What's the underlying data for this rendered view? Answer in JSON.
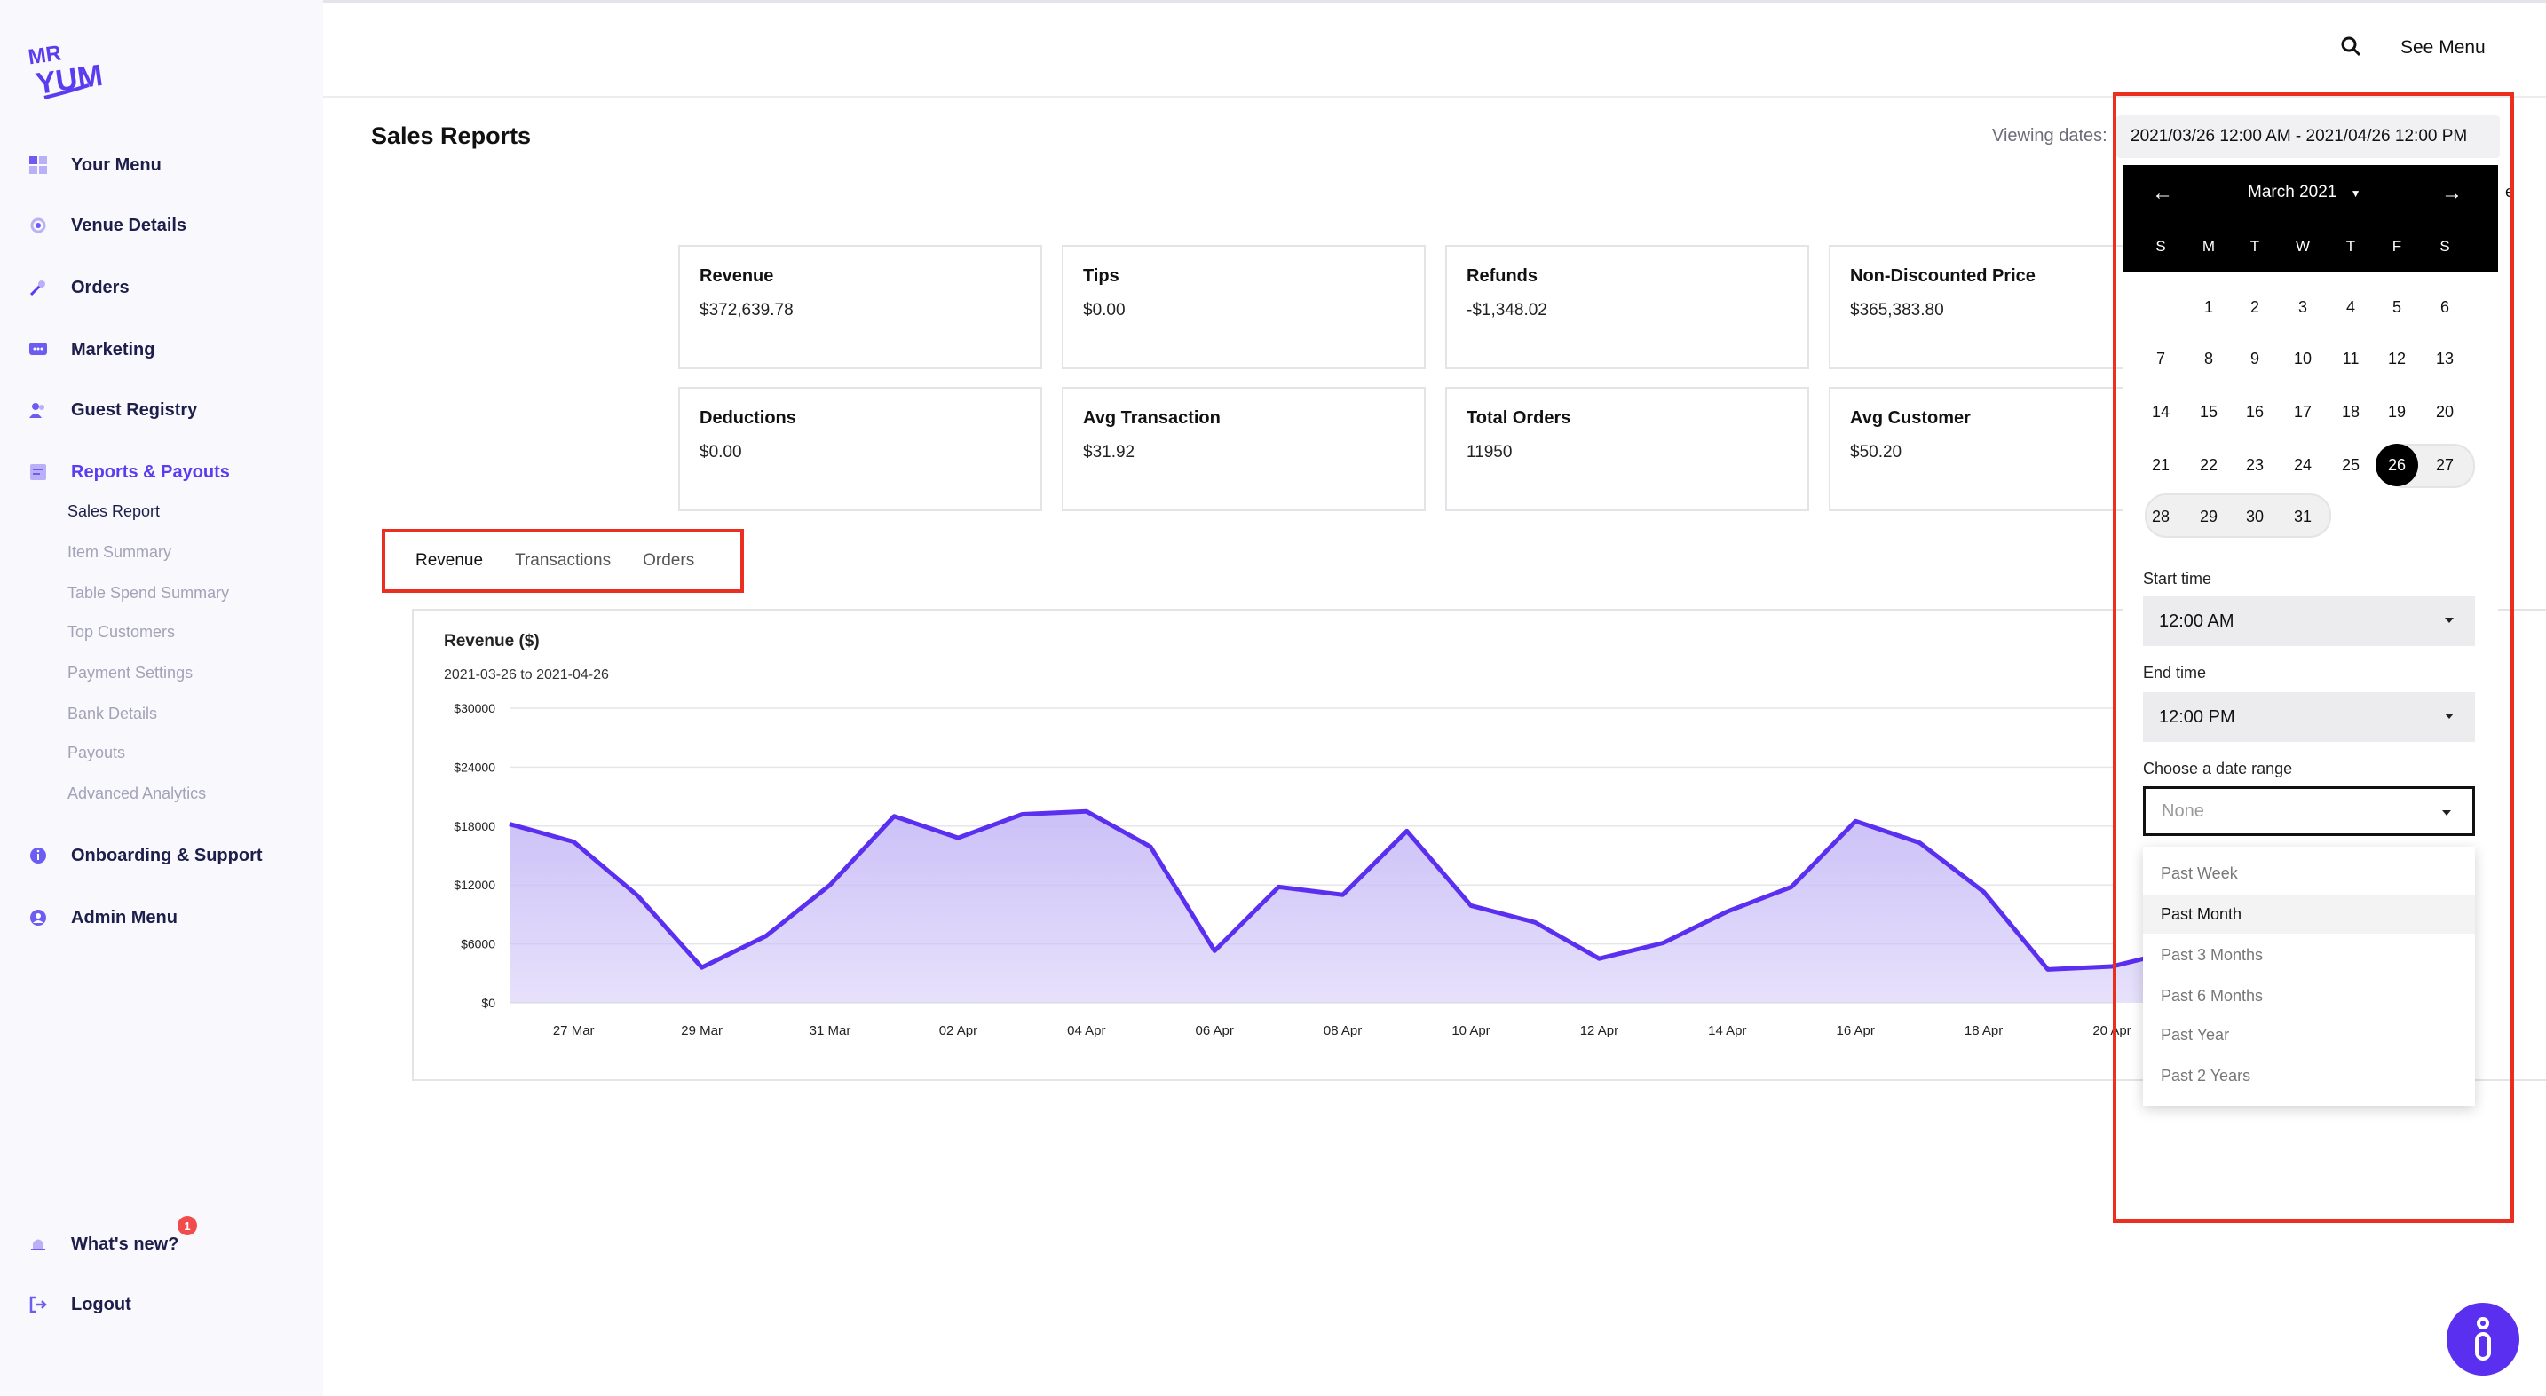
{
  "brand": {
    "logo_text_top": "MR",
    "logo_text_bottom": "YUM",
    "accent": "#5b3cf0",
    "logo_color": "#5b3cf0"
  },
  "sidebar": {
    "items": [
      {
        "label": "Your Menu",
        "icon": "grid-icon"
      },
      {
        "label": "Venue Details",
        "icon": "gear-icon"
      },
      {
        "label": "Orders",
        "icon": "wrench-icon"
      },
      {
        "label": "Marketing",
        "icon": "chat-icon"
      },
      {
        "label": "Guest Registry",
        "icon": "users-icon"
      },
      {
        "label": "Reports & Payouts",
        "icon": "report-icon",
        "active": true
      },
      {
        "label": "Onboarding & Support",
        "icon": "info-icon"
      },
      {
        "label": "Admin Menu",
        "icon": "admin-icon"
      }
    ],
    "sub_items": [
      "Sales Report",
      "Item Summary",
      "Table Spend Summary",
      "Top Customers",
      "Payment Settings",
      "Bank Details",
      "Payouts",
      "Advanced Analytics"
    ],
    "whats_new": {
      "label": "What's new?",
      "badge": "1"
    },
    "logout": "Logout"
  },
  "topbar": {
    "see_menu": "See Menu"
  },
  "page": {
    "title": "Sales Reports",
    "viewing_label": "Viewing dates:",
    "date_range": "2021/03/26 12:00 AM - 2021/04/26 12:00 PM"
  },
  "stats": [
    {
      "label": "Revenue",
      "value": "$372,639.78"
    },
    {
      "label": "Tips",
      "value": "$0.00"
    },
    {
      "label": "Refunds",
      "value": "-$1,348.02"
    },
    {
      "label": "Non-Discounted Price",
      "value": "$365,383.80"
    },
    {
      "label": "Deductions",
      "value": "$0.00"
    },
    {
      "label": "Avg Transaction",
      "value": "$31.92"
    },
    {
      "label": "Total Orders",
      "value": "11950"
    },
    {
      "label": "Avg Customer",
      "value": "$50.20"
    }
  ],
  "tabs": [
    {
      "label": "Revenue",
      "active": true
    },
    {
      "label": "Transactions"
    },
    {
      "label": "Orders"
    }
  ],
  "chart_data": {
    "type": "area",
    "title": "Revenue ($)",
    "subtitle": "2021-03-26 to 2021-04-26",
    "ylim": [
      0,
      30000
    ],
    "y_ticks": [
      "$0",
      "$6000",
      "$12000",
      "$18000",
      "$24000",
      "$30000"
    ],
    "x_ticks": [
      "27 Mar",
      "29 Mar",
      "31 Mar",
      "02 Apr",
      "04 Apr",
      "06 Apr",
      "08 Apr",
      "10 Apr",
      "12 Apr",
      "14 Apr",
      "16 Apr",
      "18 Apr",
      "20 Apr"
    ],
    "x": [
      "26 Mar",
      "27 Mar",
      "28 Mar",
      "29 Mar",
      "30 Mar",
      "31 Mar",
      "01 Apr",
      "02 Apr",
      "03 Apr",
      "04 Apr",
      "05 Apr",
      "06 Apr",
      "07 Apr",
      "08 Apr",
      "09 Apr",
      "10 Apr",
      "11 Apr",
      "12 Apr",
      "13 Apr",
      "14 Apr",
      "15 Apr",
      "16 Apr",
      "17 Apr",
      "18 Apr",
      "19 Apr",
      "20 Apr",
      "21 Apr"
    ],
    "values": [
      18200,
      16400,
      10900,
      3600,
      6800,
      12000,
      19000,
      16800,
      19200,
      19500,
      15900,
      5300,
      11800,
      11000,
      17500,
      9900,
      8200,
      4500,
      6100,
      9300,
      11800,
      18500,
      16300,
      11300,
      3400,
      3700,
      5300
    ],
    "line_color": "#5a2ff0",
    "fill_color": "#c9bdf7",
    "grid": true
  },
  "datepicker": {
    "month_label": "March 2021",
    "weekdays": [
      "S",
      "M",
      "T",
      "W",
      "T",
      "F",
      "S"
    ],
    "weeks": [
      [
        "",
        "1",
        "2",
        "3",
        "4",
        "5",
        "6"
      ],
      [
        "7",
        "8",
        "9",
        "10",
        "11",
        "12",
        "13"
      ],
      [
        "14",
        "15",
        "16",
        "17",
        "18",
        "19",
        "20"
      ],
      [
        "21",
        "22",
        "23",
        "24",
        "25",
        "26",
        "27"
      ],
      [
        "28",
        "29",
        "30",
        "31",
        "",
        "",
        ""
      ]
    ],
    "selected_day": "26",
    "start_time_label": "Start time",
    "start_time": "12:00 AM",
    "end_time_label": "End time",
    "end_time": "12:00 PM",
    "range_label": "Choose a date range",
    "range_placeholder": "None",
    "range_options": [
      "Past Week",
      "Past Month",
      "Past 3 Months",
      "Past 6 Months",
      "Past Year",
      "Past 2 Years"
    ],
    "highlighted_option": "Past Month",
    "overflow_char": "e"
  }
}
